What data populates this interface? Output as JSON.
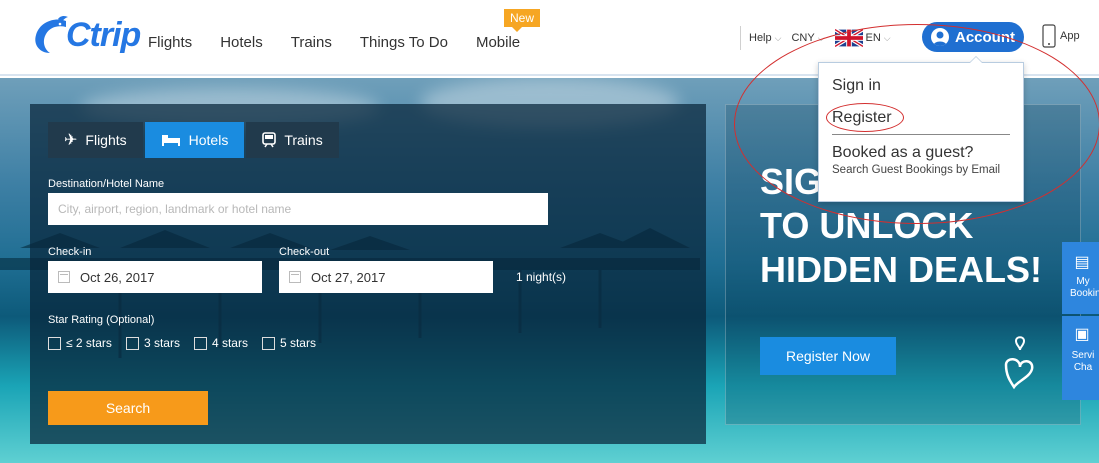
{
  "header": {
    "logo_text": "Ctrip",
    "nav": [
      "Flights",
      "Hotels",
      "Trains",
      "Things To Do",
      "Mobile"
    ],
    "new_badge": "New",
    "help": "Help",
    "currency": "CNY",
    "language": "EN",
    "account": "Account",
    "app": "App"
  },
  "account_menu": {
    "sign_in": "Sign in",
    "register": "Register",
    "guest_title": "Booked as a guest?",
    "guest_link": "Search Guest Bookings by Email"
  },
  "search": {
    "tabs": [
      "Flights",
      "Hotels",
      "Trains"
    ],
    "active_tab": "Hotels",
    "destination_label": "Destination/Hotel Name",
    "destination_placeholder": "City, airport, region, landmark or hotel name",
    "checkin_label": "Check-in",
    "checkin_value": "Oct 26, 2017",
    "checkout_label": "Check-out",
    "checkout_value": "Oct 27, 2017",
    "nights": "1 night(s)",
    "star_label": "Star Rating (Optional)",
    "star_options": [
      "≤ 2 stars",
      "3 stars",
      "4 stars",
      "5 stars"
    ],
    "search_button": "Search"
  },
  "promo": {
    "line1": "SIG",
    "line2": "TO UNLOCK",
    "line3": "HIDDEN DEALS!",
    "button": "Register Now"
  },
  "side_widgets": [
    {
      "label": "My Bookin"
    },
    {
      "label": "Servi Cha"
    }
  ],
  "colors": {
    "brand_blue": "#2577e3",
    "account_blue": "#1f6fd1",
    "search_orange": "#f79a1a",
    "annotation_red": "#d32f2f"
  }
}
